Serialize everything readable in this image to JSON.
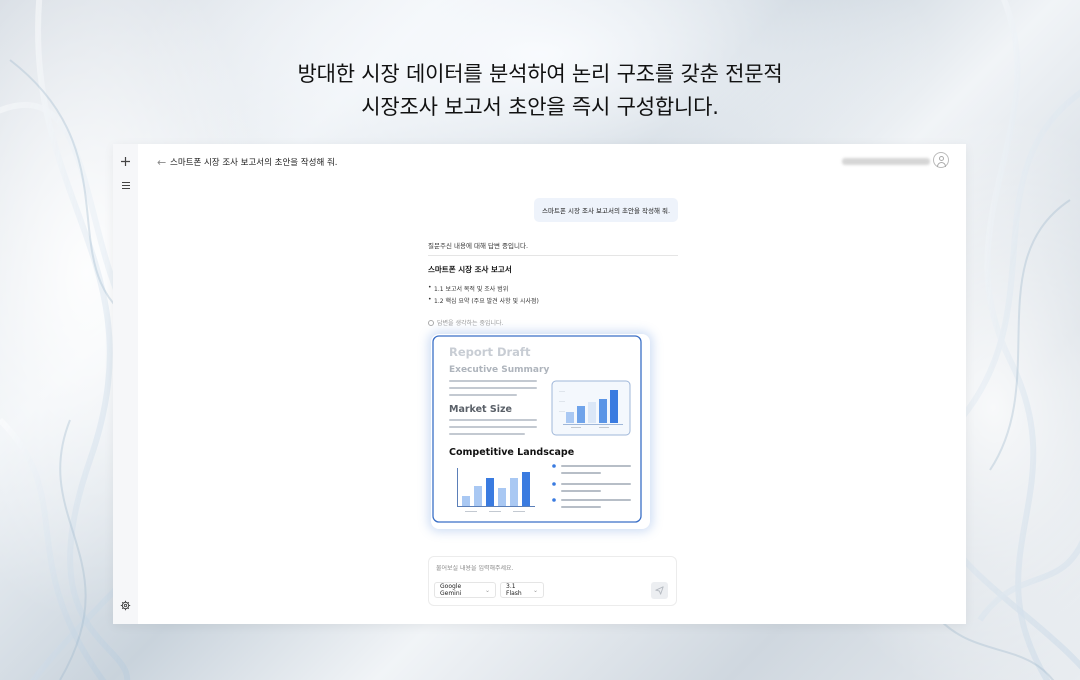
{
  "headline": {
    "line1": "방대한 시장 데이터를 분석하여 논리 구조를 갖춘 전문적",
    "line2": "시장조사 보고서 초안을 즉시 구성합니다."
  },
  "sidebar": {
    "new_chat_icon": "plus-icon",
    "menu_icon": "hamburger-icon",
    "settings_icon": "gear-icon"
  },
  "header": {
    "back_glyph": "←",
    "title": "스마트폰 시장 조사 보고서의 초안을 작성해 줘."
  },
  "chat": {
    "user_message": "스마트폰 시장 조사 보고서의 초안을 작성해 줘.",
    "answer_status": "질문주신 내용에 대해 답변 중입니다.",
    "answer_heading": "스마트폰 시장 조사 보고서",
    "answer_items": [
      "1.1 보고서 목적 및 조사 범위",
      "1.2 핵심 요약 (주요 발견 사항 및 시사점)"
    ],
    "thinking_text": "답변을 생각하는 중입니다."
  },
  "report_preview": {
    "title": "Report Draft",
    "section1": "Executive Summary",
    "section2": "Market Size",
    "section3": "Competitive Landscape",
    "accent_color": "#3a7be0",
    "light_bar_color": "#a9c8f3"
  },
  "composer": {
    "placeholder": "물어보실 내용을 입력해주세요.",
    "model_select": "Google Gemini",
    "version_select": "3.1 Flash",
    "send_icon": "send-icon"
  }
}
